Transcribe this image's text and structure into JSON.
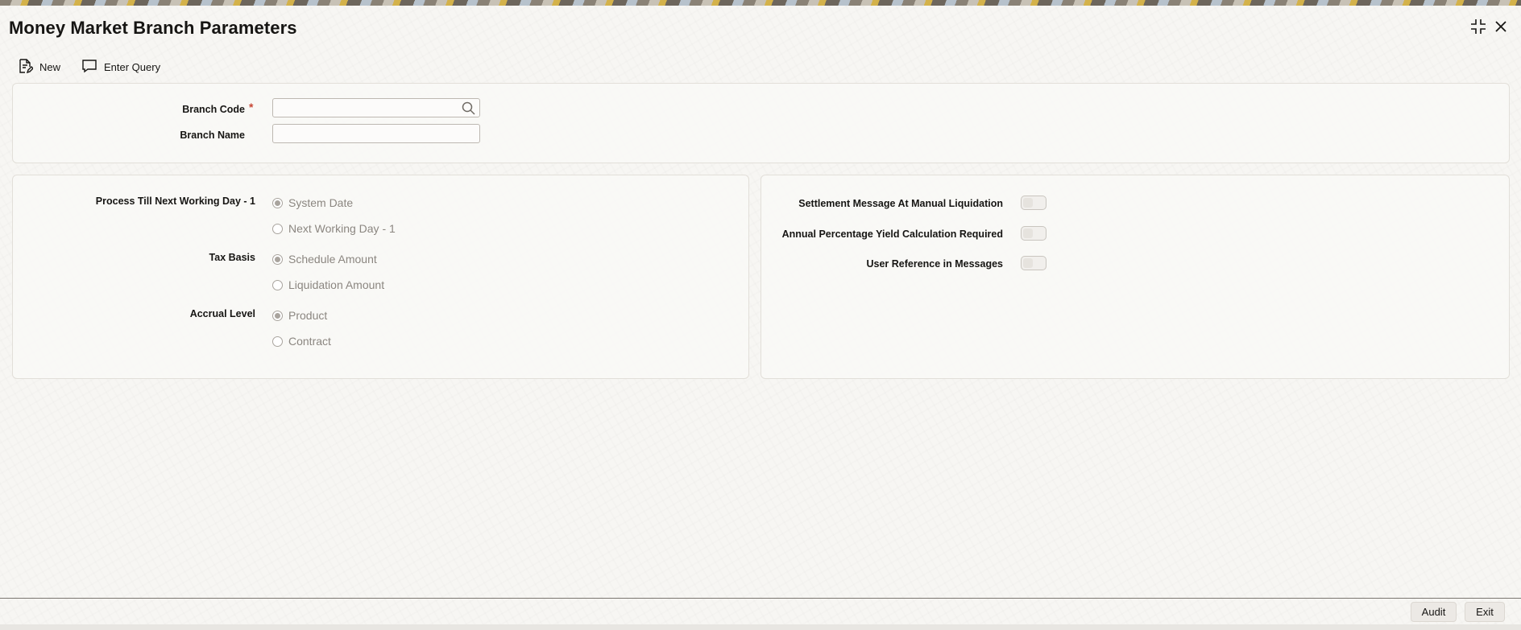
{
  "window": {
    "title": "Money Market Branch Parameters"
  },
  "toolbar": {
    "new_label": "New",
    "enter_query_label": "Enter Query"
  },
  "header_panel": {
    "branch_code_label": "Branch Code",
    "required_marker": "*",
    "branch_code_value": "",
    "branch_name_label": "Branch Name",
    "branch_name_value": ""
  },
  "left_panel": {
    "process_label": "Process Till Next Working Day - 1",
    "process_options": [
      "System Date",
      "Next Working Day - 1"
    ],
    "process_selected": "System Date",
    "tax_basis_label": "Tax Basis",
    "tax_basis_options": [
      "Schedule Amount",
      "Liquidation Amount"
    ],
    "tax_basis_selected": "Schedule Amount",
    "accrual_label": "Accrual Level",
    "accrual_options": [
      "Product",
      "Contract"
    ],
    "accrual_selected": "Product"
  },
  "right_panel": {
    "settlement_label": "Settlement Message At Manual Liquidation",
    "settlement_on": false,
    "apy_label": "Annual Percentage Yield Calculation Required",
    "apy_on": false,
    "user_ref_label": "User Reference in Messages",
    "user_ref_on": false
  },
  "footer": {
    "audit_label": "Audit",
    "exit_label": "Exit"
  },
  "icons": {
    "new": "new-document-icon",
    "enter_query": "speech-bubble-icon",
    "search": "search-icon",
    "minimize": "collapse-icon",
    "close": "close-icon"
  }
}
